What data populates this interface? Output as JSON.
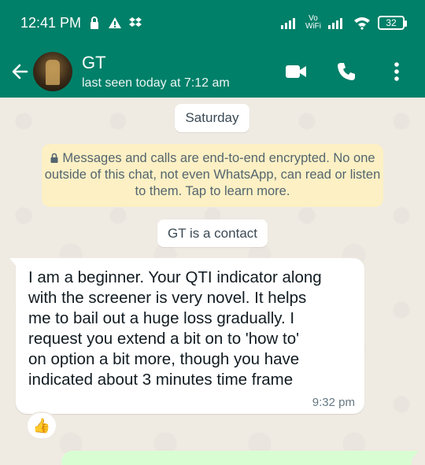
{
  "status_bar": {
    "time": "12:41 PM",
    "vo_top": "Vo",
    "vo_bottom": "WiFi",
    "battery": "32"
  },
  "chat_header": {
    "name": "GT",
    "last_seen": "last seen today at 7:12 am"
  },
  "chat": {
    "date_chip": "Saturday",
    "encryption_notice": "Messages and calls are end-to-end encrypted. No one outside of this chat, not even WhatsApp, can read or listen to them. Tap to learn more.",
    "contact_chip": "GT is a contact",
    "incoming_message": {
      "text": "I am a beginner.  Your QTI indicator along\nwith the screener is very novel.  It helps\nme to bail out a huge loss gradually.  I\nrequest you extend a bit on to 'how to'\non option a bit more, though you have\nindicated about 3 minutes time frame",
      "time": "9:32 pm",
      "reaction": "👍"
    }
  },
  "colors": {
    "header": "#008069",
    "background": "#efeae2",
    "notice": "#fcf0c4",
    "outgoing": "#d9fdd3"
  },
  "icons": [
    "lock-icon",
    "alert-icon",
    "dropbox-icon",
    "signal-icon",
    "wifi-icon",
    "battery-icon",
    "back-arrow-icon",
    "video-call-icon",
    "voice-call-icon",
    "more-options-icon"
  ]
}
